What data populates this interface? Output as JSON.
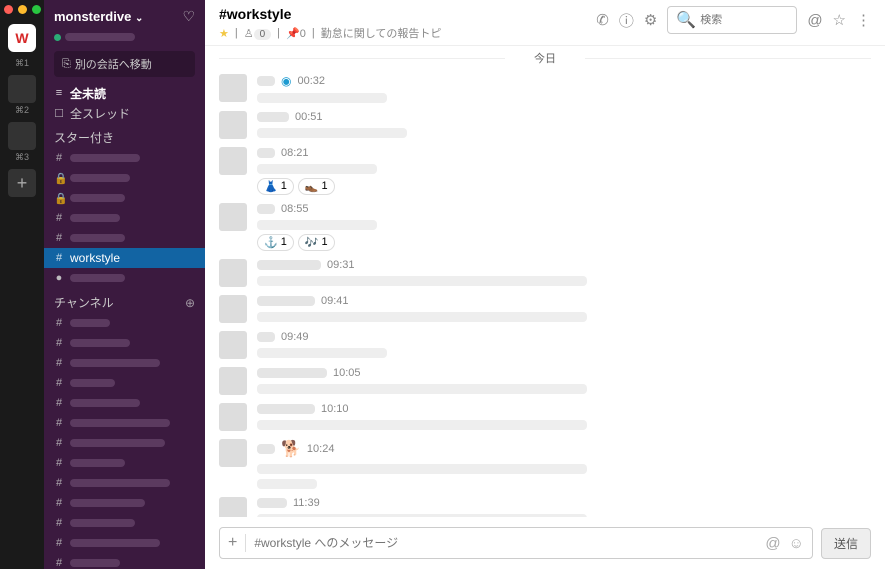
{
  "rail": {
    "k1": "⌘1",
    "k2": "⌘2",
    "k3": "⌘3"
  },
  "workspace": {
    "name": "monsterdive"
  },
  "jump": "別の会話へ移動",
  "nav": {
    "unread": "全未読",
    "threads": "全スレッド"
  },
  "sections": {
    "starred": "スター付き",
    "channels": "チャンネル"
  },
  "active_channel": "workstyle",
  "header": {
    "title": "#workstyle",
    "members": "0",
    "pins": "0",
    "topic": "勤怠に関しての報告トピ"
  },
  "search_placeholder": "検索",
  "divider": "今日",
  "messages": [
    {
      "nmw": 18,
      "time": "00:32",
      "spiral": true,
      "lines": [
        130
      ]
    },
    {
      "nmw": 32,
      "time": "00:51",
      "lines": [
        150
      ]
    },
    {
      "nmw": 18,
      "time": "08:21",
      "lines": [
        120
      ],
      "reacts": [
        {
          "e": "👗",
          "c": "1"
        },
        {
          "e": "👞",
          "c": "1"
        }
      ]
    },
    {
      "nmw": 18,
      "time": "08:55",
      "lines": [
        120
      ],
      "reacts": [
        {
          "e": "⚓",
          "c": "1"
        },
        {
          "e": "🎶",
          "c": "1"
        }
      ]
    },
    {
      "nmw": 64,
      "time": "09:31",
      "lines": [
        330
      ]
    },
    {
      "nmw": 58,
      "time": "09:41",
      "lines": [
        330
      ]
    },
    {
      "nmw": 18,
      "time": "09:49",
      "lines": [
        130
      ]
    },
    {
      "nmw": 70,
      "time": "10:05",
      "lines": [
        330
      ]
    },
    {
      "nmw": 58,
      "time": "10:10",
      "lines": [
        330
      ]
    },
    {
      "nmw": 18,
      "time": "10:24",
      "emoji": "🐕",
      "lines": [
        330,
        60
      ]
    },
    {
      "nmw": 30,
      "time": "11:39",
      "lines": [
        330
      ]
    }
  ],
  "composer": {
    "placeholder": "#workstyle へのメッセージ",
    "send": "送信"
  }
}
